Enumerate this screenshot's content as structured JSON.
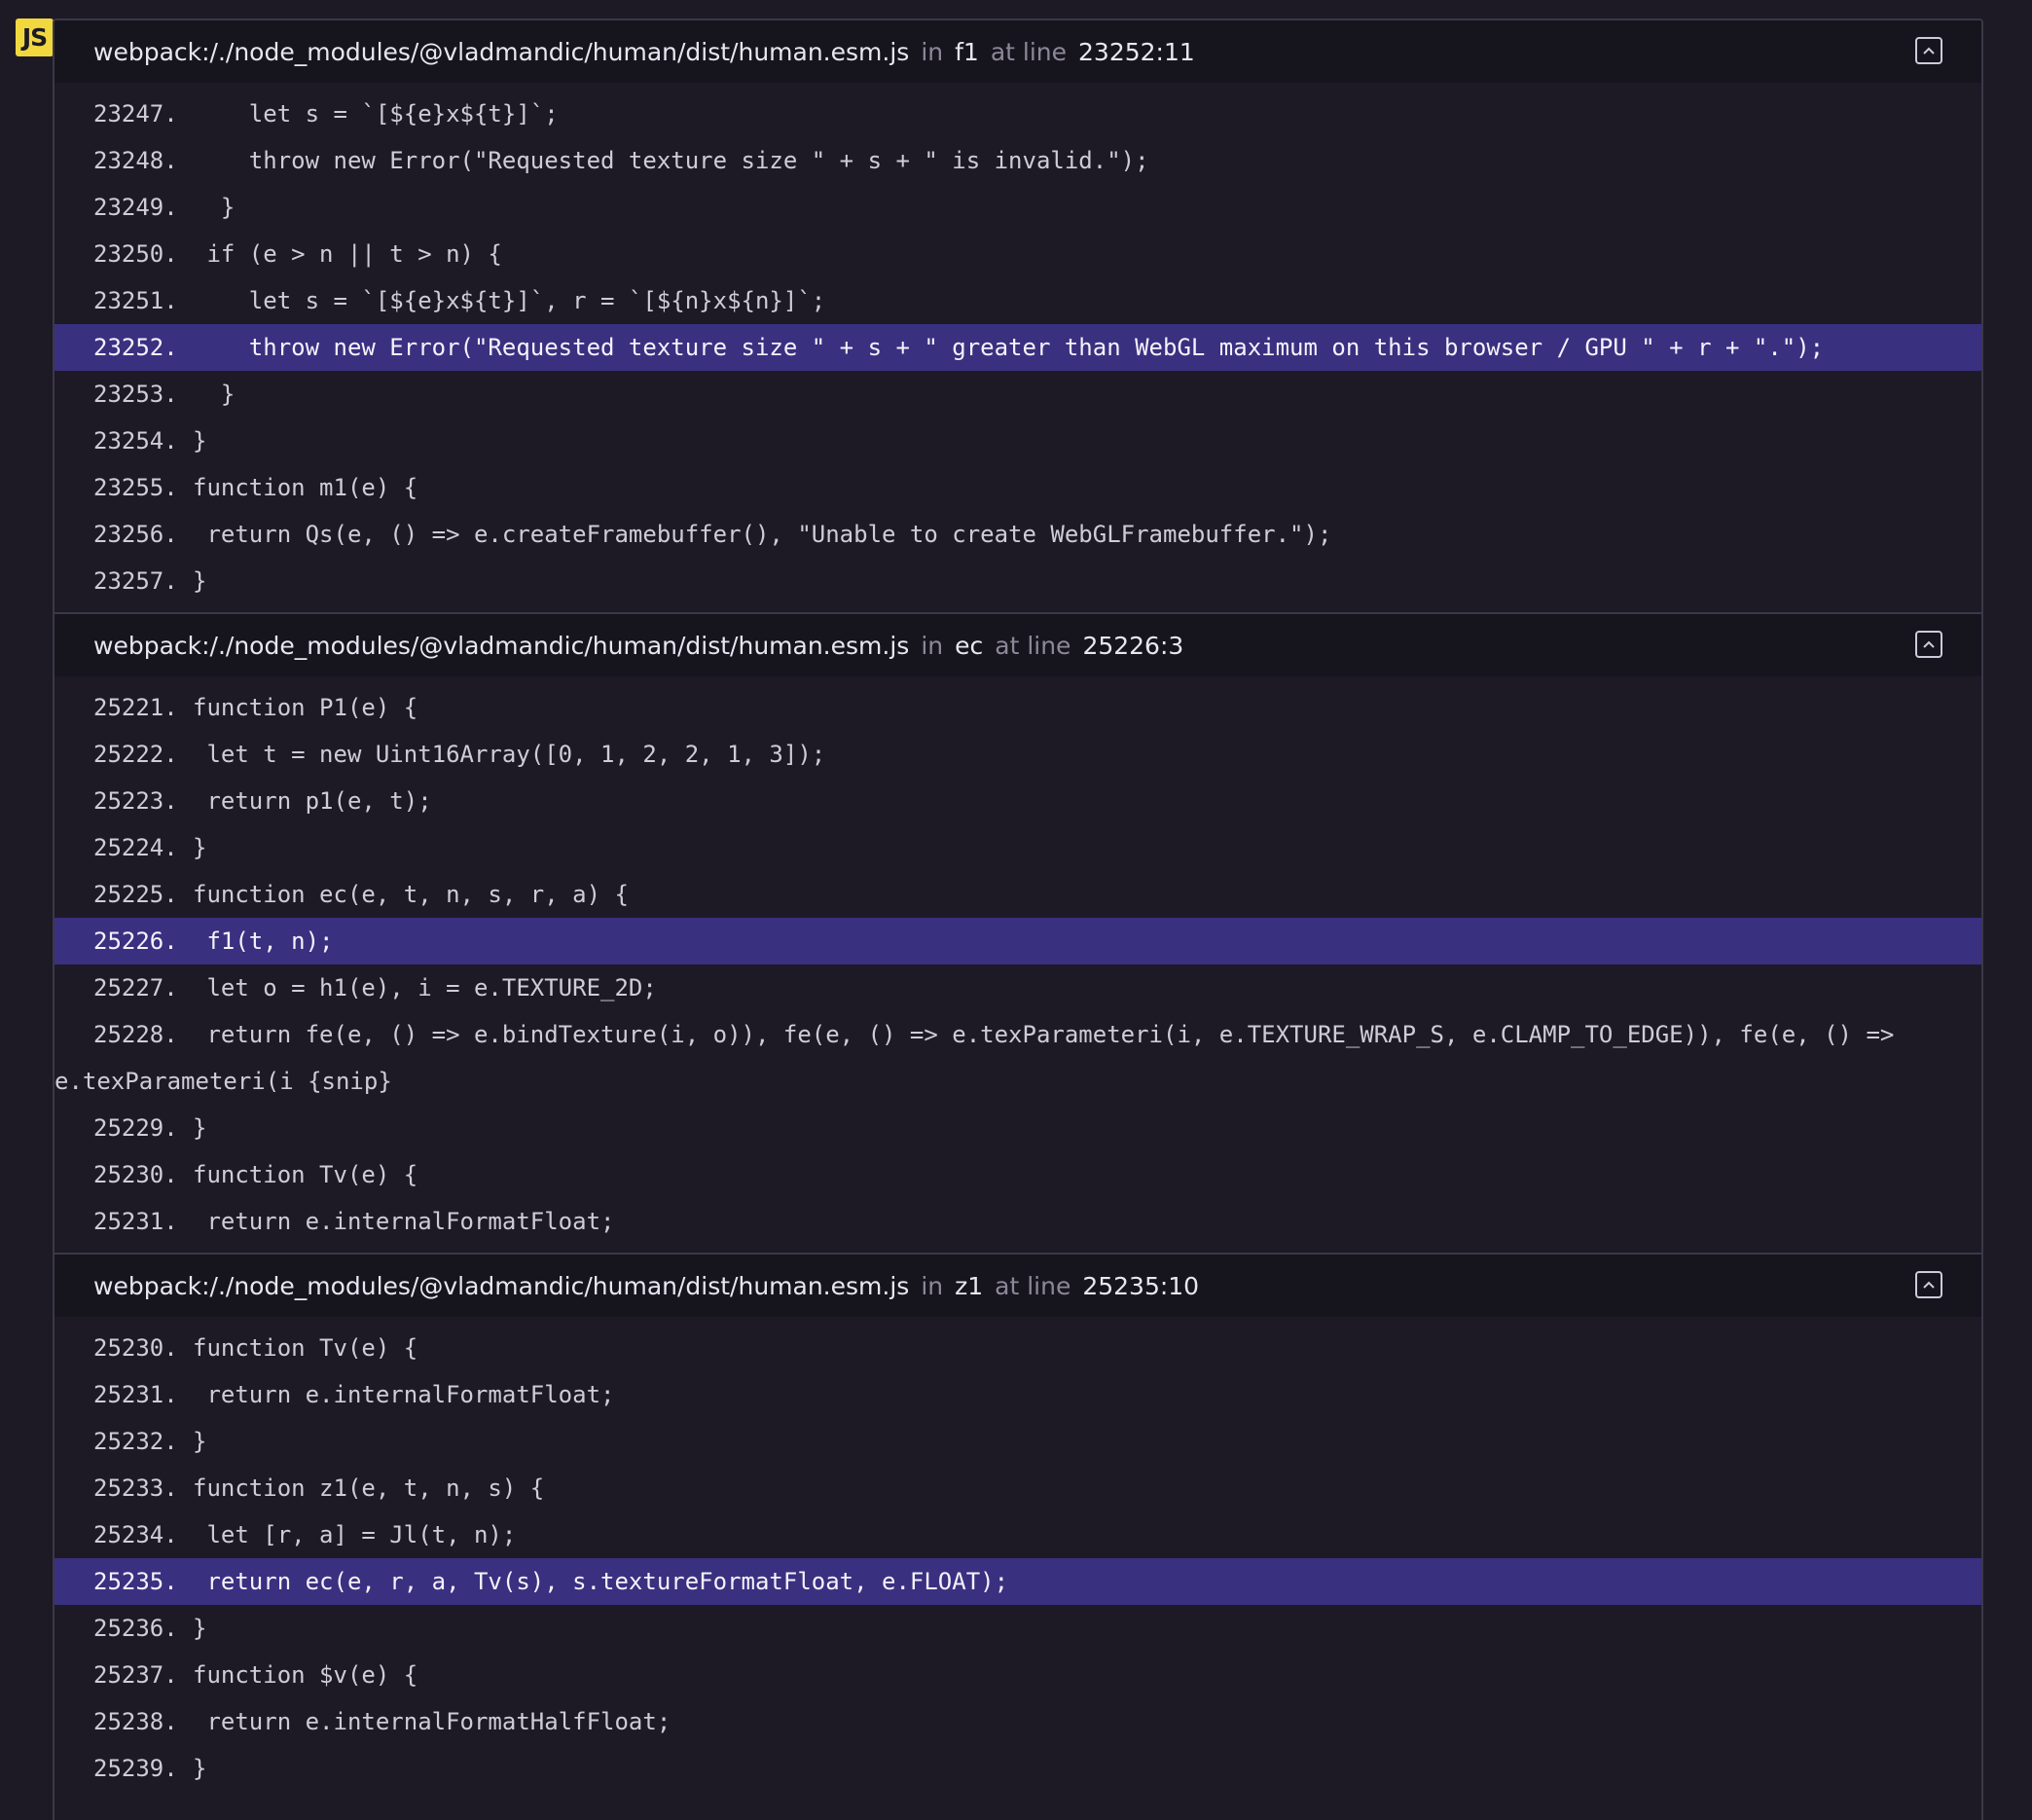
{
  "badge": "JS",
  "frames": [
    {
      "path": "webpack:/./node_modules/@vladmandic/human/dist/human.esm.js",
      "in_label": "in",
      "function": "f1",
      "at_line_label": "at line",
      "location": "23252:11",
      "lines": [
        {
          "no": "23247.",
          "code": "    let s = `[${e}x${t}]`;",
          "active": false
        },
        {
          "no": "23248.",
          "code": "    throw new Error(\"Requested texture size \" + s + \" is invalid.\");",
          "active": false
        },
        {
          "no": "23249.",
          "code": "  }",
          "active": false
        },
        {
          "no": "23250.",
          "code": " if (e > n || t > n) {",
          "active": false
        },
        {
          "no": "23251.",
          "code": "    let s = `[${e}x${t}]`, r = `[${n}x${n}]`;",
          "active": false
        },
        {
          "no": "23252.",
          "code": "    throw new Error(\"Requested texture size \" + s + \" greater than WebGL maximum on this browser / GPU \" + r + \".\");",
          "active": true
        },
        {
          "no": "23253.",
          "code": "  }",
          "active": false
        },
        {
          "no": "23254.",
          "code": "}",
          "active": false
        },
        {
          "no": "23255.",
          "code": "function m1(e) {",
          "active": false
        },
        {
          "no": "23256.",
          "code": " return Qs(e, () => e.createFramebuffer(), \"Unable to create WebGLFramebuffer.\");",
          "active": false
        },
        {
          "no": "23257.",
          "code": "}",
          "active": false
        }
      ]
    },
    {
      "path": "webpack:/./node_modules/@vladmandic/human/dist/human.esm.js",
      "in_label": "in",
      "function": "ec",
      "at_line_label": "at line",
      "location": "25226:3",
      "lines": [
        {
          "no": "25221.",
          "code": "function P1(e) {",
          "active": false
        },
        {
          "no": "25222.",
          "code": " let t = new Uint16Array([0, 1, 2, 2, 1, 3]);",
          "active": false
        },
        {
          "no": "25223.",
          "code": " return p1(e, t);",
          "active": false
        },
        {
          "no": "25224.",
          "code": "}",
          "active": false
        },
        {
          "no": "25225.",
          "code": "function ec(e, t, n, s, r, a) {",
          "active": false
        },
        {
          "no": "25226.",
          "code": " f1(t, n);",
          "active": true
        },
        {
          "no": "25227.",
          "code": " let o = h1(e), i = e.TEXTURE_2D;",
          "active": false
        },
        {
          "no": "25228.",
          "code": " return fe(e, () => e.bindTexture(i, o)), fe(e, () => e.texParameteri(i, e.TEXTURE_WRAP_S, e.CLAMP_TO_EDGE)), fe(e, () =>",
          "active": false
        },
        {
          "no": "",
          "code": "e.texParameteri(i {snip}",
          "active": false,
          "continuation": true
        },
        {
          "no": "25229.",
          "code": "}",
          "active": false
        },
        {
          "no": "25230.",
          "code": "function Tv(e) {",
          "active": false
        },
        {
          "no": "25231.",
          "code": " return e.internalFormatFloat;",
          "active": false
        }
      ]
    },
    {
      "path": "webpack:/./node_modules/@vladmandic/human/dist/human.esm.js",
      "in_label": "in",
      "function": "z1",
      "at_line_label": "at line",
      "location": "25235:10",
      "lines": [
        {
          "no": "25230.",
          "code": "function Tv(e) {",
          "active": false
        },
        {
          "no": "25231.",
          "code": " return e.internalFormatFloat;",
          "active": false
        },
        {
          "no": "25232.",
          "code": "}",
          "active": false
        },
        {
          "no": "25233.",
          "code": "function z1(e, t, n, s) {",
          "active": false
        },
        {
          "no": "25234.",
          "code": " let [r, a] = Jl(t, n);",
          "active": false
        },
        {
          "no": "25235.",
          "code": " return ec(e, r, a, Tv(s), s.textureFormatFloat, e.FLOAT);",
          "active": true
        },
        {
          "no": "25236.",
          "code": "}",
          "active": false
        },
        {
          "no": "25237.",
          "code": "function $v(e) {",
          "active": false
        },
        {
          "no": "25238.",
          "code": " return e.internalFormatHalfFloat;",
          "active": false
        },
        {
          "no": "25239.",
          "code": "}",
          "active": false
        }
      ]
    }
  ]
}
